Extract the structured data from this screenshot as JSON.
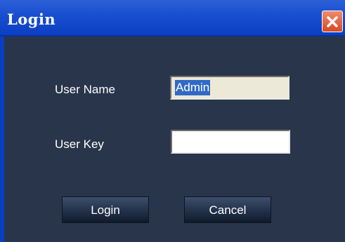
{
  "window": {
    "title": "Login",
    "close_icon": "close-icon"
  },
  "form": {
    "username_label": "User Name",
    "username_value": "Admin",
    "userkey_label": "User Key",
    "userkey_value": ""
  },
  "buttons": {
    "login_label": "Login",
    "cancel_label": "Cancel"
  },
  "colors": {
    "titlebar": "#0a3fc2",
    "background": "#29354a",
    "selection": "#316ac5",
    "close": "#d64a25"
  }
}
